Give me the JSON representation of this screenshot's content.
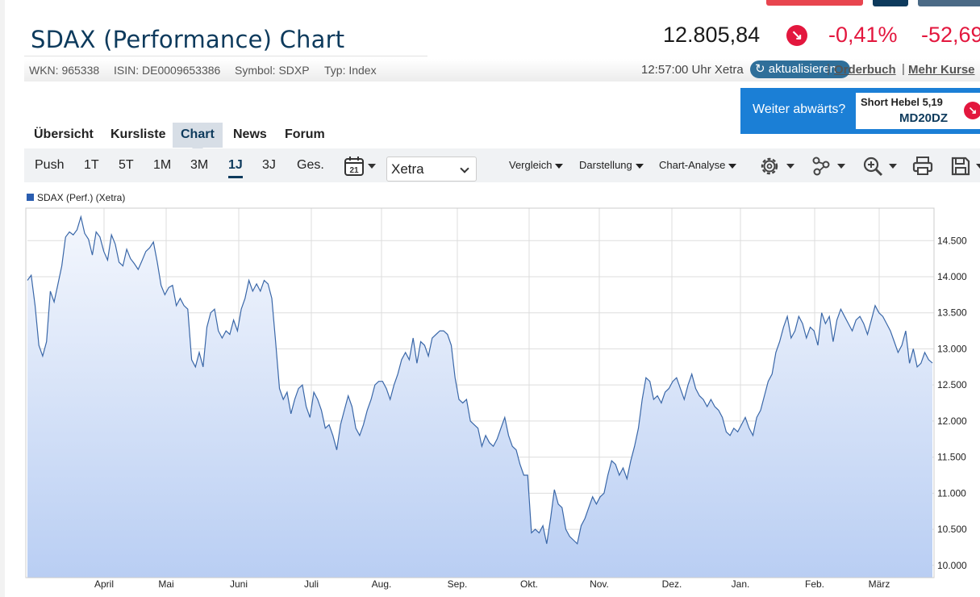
{
  "page": {
    "title": "SDAX (Performance) Chart",
    "accent": "#0d3a5c",
    "negative": "#e3173e"
  },
  "quote": {
    "price": "12.805,84",
    "direction_icon": "arrow-down-right-icon",
    "change_pct": "-0,41%",
    "change_abs": "-52,69"
  },
  "meta": {
    "wkn": "WKN: 965338",
    "isin": "ISIN: DE0009653386",
    "symbol": "Symbol: SDXP",
    "type": "Typ: Index",
    "time": "12:57:00 Uhr Xetra",
    "refresh_label": "aktualisieren",
    "orderbook": "Orderbuch",
    "more": "Mehr Kurse"
  },
  "promo": {
    "text": "Weiter abwärts?",
    "product": "Short Hebel 5,19",
    "code": "MD20DZ"
  },
  "tabs": [
    {
      "label": "Übersicht",
      "active": false
    },
    {
      "label": "Kursliste",
      "active": false
    },
    {
      "label": "Chart",
      "active": true
    },
    {
      "label": "News",
      "active": false
    },
    {
      "label": "Forum",
      "active": false
    }
  ],
  "toolbar": {
    "ranges": [
      "Push",
      "1T",
      "5T",
      "1M",
      "3M",
      "1J",
      "3J",
      "Ges."
    ],
    "active_range": "1J",
    "calendar_day": "21",
    "exchange": "Xetra",
    "menus": [
      "Vergleich",
      "Darstellung",
      "Chart-Analyse"
    ],
    "icons": [
      "settings-icon",
      "indicators-icon",
      "zoom-in-icon",
      "print-icon",
      "save-icon"
    ]
  },
  "chart_data": {
    "type": "area",
    "legend": [
      "SDAX (Perf.) (Xetra)"
    ],
    "legend_position": "top-left",
    "grid": true,
    "line_color": "#3a67a8",
    "fill_top": "#f4f7fd",
    "fill_bottom": "#b9cef3",
    "x_ticks": [
      "April",
      "Mai",
      "Juni",
      "Juli",
      "Aug.",
      "Sep.",
      "Okt.",
      "Nov.",
      "Dez.",
      "Jan.",
      "Feb.",
      "März"
    ],
    "y_ticks": [
      "10.000",
      "10.500",
      "11.000",
      "11.500",
      "12.000",
      "12.500",
      "13.000",
      "13.500",
      "14.000",
      "14.500"
    ],
    "y_tick_values": [
      10000,
      10500,
      11000,
      11500,
      12000,
      12500,
      13000,
      13500,
      14000,
      14500
    ],
    "ylim": [
      9830,
      14950
    ],
    "series": [
      {
        "values": [
          13950,
          14020,
          13600,
          13050,
          12900,
          13100,
          13800,
          13650,
          13900,
          14150,
          14550,
          14620,
          14580,
          14650,
          14830,
          14600,
          14520,
          14300,
          14620,
          14550,
          14350,
          14230,
          14580,
          14450,
          14200,
          14150,
          14380,
          14250,
          14180,
          14100,
          14220,
          14350,
          14400,
          14480,
          14200,
          13880,
          13750,
          13850,
          13880,
          13600,
          13700,
          13600,
          13550,
          12850,
          12750,
          12950,
          12750,
          13300,
          13500,
          13550,
          13250,
          13150,
          13250,
          13200,
          13400,
          13250,
          13550,
          13700,
          13950,
          13800,
          13900,
          13800,
          13950,
          13900,
          13700,
          13100,
          12450,
          12300,
          12400,
          12100,
          12300,
          12450,
          12500,
          12200,
          12050,
          12400,
          12300,
          12150,
          11900,
          11950,
          11800,
          11600,
          11950,
          12150,
          12350,
          12200,
          11900,
          11800,
          11950,
          12150,
          12300,
          12500,
          12550,
          12550,
          12450,
          12300,
          12500,
          12650,
          12850,
          12950,
          12850,
          13150,
          12800,
          13100,
          13050,
          12900,
          13150,
          13200,
          13250,
          13250,
          13200,
          13050,
          12600,
          12300,
          12250,
          12300,
          12000,
          11950,
          11900,
          11650,
          11800,
          11700,
          11650,
          11750,
          11900,
          12050,
          11800,
          11650,
          11600,
          11400,
          11250,
          11250,
          10450,
          10500,
          10450,
          10550,
          10300,
          10650,
          11050,
          10850,
          10800,
          10500,
          10400,
          10350,
          10300,
          10550,
          10650,
          10800,
          10950,
          10850,
          10950,
          11000,
          11250,
          11450,
          11400,
          11250,
          11350,
          11200,
          11450,
          11650,
          11900,
          12300,
          12600,
          12550,
          12300,
          12350,
          12250,
          12400,
          12450,
          12550,
          12600,
          12450,
          12300,
          12500,
          12650,
          12450,
          12350,
          12300,
          12200,
          12300,
          12200,
          12150,
          12050,
          11850,
          11800,
          11900,
          11850,
          11950,
          12050,
          11900,
          11800,
          12050,
          12150,
          12350,
          12550,
          12650,
          12950,
          13100,
          13300,
          13450,
          13150,
          13250,
          13450,
          13350,
          13150,
          13300,
          13250,
          13050,
          13500,
          13350,
          13450,
          13100,
          13400,
          13550,
          13450,
          13350,
          13250,
          13400,
          13450,
          13350,
          13200,
          13400,
          13600,
          13500,
          13450,
          13350,
          13250,
          13100,
          12950,
          13050,
          13250,
          12800,
          13000,
          12750,
          12800,
          12950,
          12850,
          12805
        ]
      }
    ]
  }
}
